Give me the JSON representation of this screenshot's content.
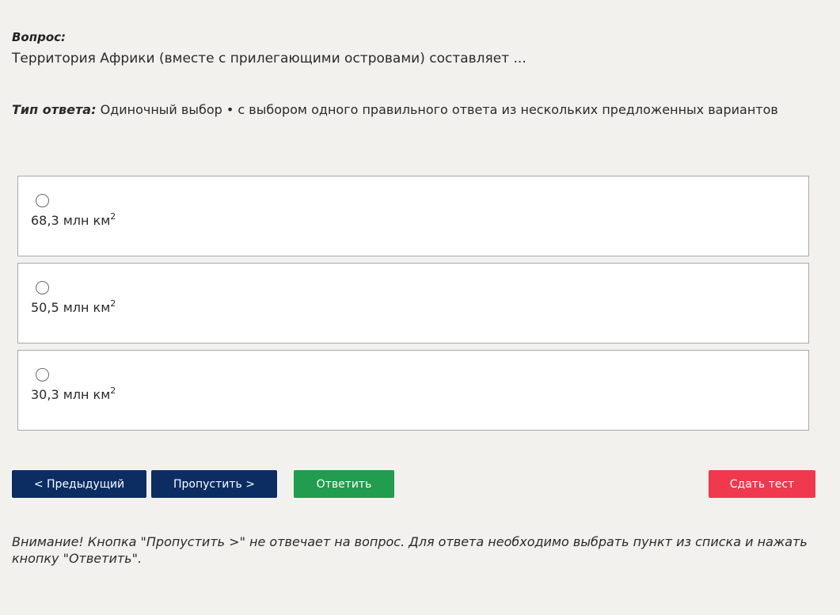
{
  "question": {
    "label": "Вопрос:",
    "text": "Территория Африки (вместе с прилегающими островами) составляет ..."
  },
  "answer_type": {
    "label": "Тип ответа:",
    "value": "Одиночный выбор • с выбором одного правильного ответа из нескольких предложенных вариантов"
  },
  "options": [
    {
      "text": "68,3 млн км",
      "sup": "2",
      "selected": false
    },
    {
      "text": "50,5 млн км",
      "sup": "2",
      "selected": false
    },
    {
      "text": "30,3 млн км",
      "sup": "2",
      "selected": false
    }
  ],
  "buttons": {
    "prev": "< Предыдущий",
    "skip": "Пропустить >",
    "answer": "Ответить",
    "submit": "Сдать тест"
  },
  "warning": "Внимание! Кнопка \"Пропустить >\" не отвечает на вопрос. Для ответа необходимо выбрать пункт из списка и нажать кнопку \"Ответить\".",
  "colors": {
    "background": "#f2f1ee",
    "nav_button": "#0b2d62",
    "answer_button": "#229c4e",
    "submit_button": "#f0384f"
  }
}
